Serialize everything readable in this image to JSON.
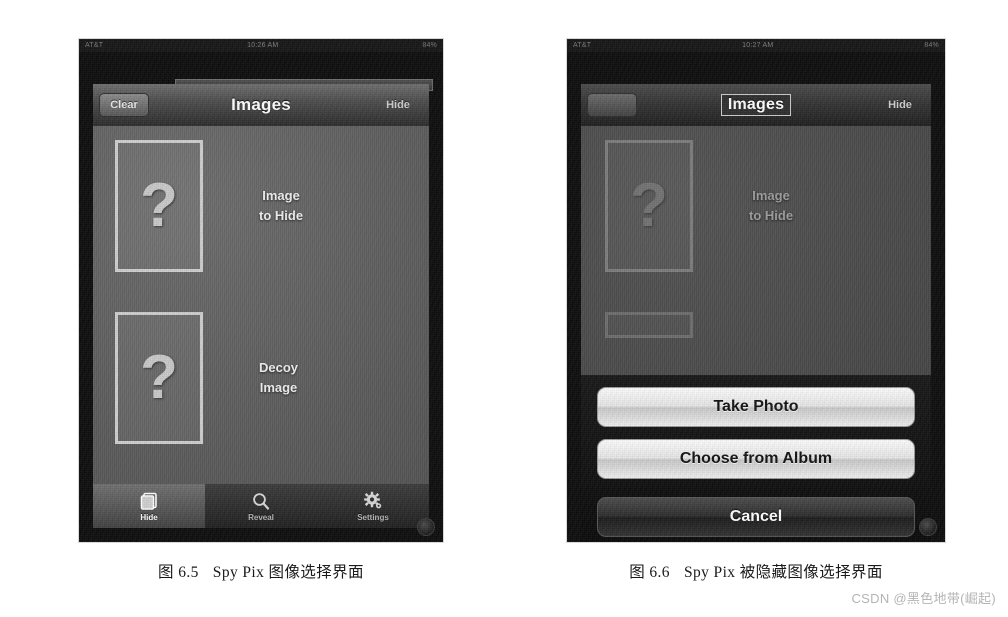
{
  "page": {
    "background_color": "#ffffff",
    "watermark": "CSDN @黑色地带(崛起)"
  },
  "figures": [
    {
      "id": "figure-6-5",
      "caption_number": "图 6.5",
      "caption_text": "Spy Pix 图像选择界面",
      "screen": {
        "status_bar": {
          "carrier": "AT&T",
          "time": "10:26 AM",
          "battery": "84%"
        },
        "nav_bar": {
          "left_button": "Clear",
          "title": "Images",
          "right_button": "Hide"
        },
        "slots": [
          {
            "thumbnail_placeholder": "?",
            "label_line1": "Image",
            "label_line2": "to Hide"
          },
          {
            "thumbnail_placeholder": "?",
            "label_line1": "Decoy",
            "label_line2": "Image"
          }
        ],
        "tab_bar": [
          {
            "label": "Hide",
            "icon": "layers-icon",
            "selected": true
          },
          {
            "label": "Reveal",
            "icon": "magnifier-icon",
            "selected": false
          },
          {
            "label": "Settings",
            "icon": "gear-icon",
            "selected": false
          }
        ]
      }
    },
    {
      "id": "figure-6-6",
      "caption_number": "图 6.6",
      "caption_text": "Spy Pix 被隐藏图像选择界面",
      "screen": {
        "status_bar": {
          "carrier": "AT&T",
          "time": "10:27 AM",
          "battery": "84%"
        },
        "nav_bar": {
          "left_button": "",
          "title": "Images",
          "right_button": "Hide"
        },
        "slots": [
          {
            "thumbnail_placeholder": "?",
            "label_line1": "Image",
            "label_line2": "to Hide"
          }
        ],
        "action_sheet": {
          "buttons": [
            {
              "label": "Take Photo",
              "style": "light"
            },
            {
              "label": "Choose from Album",
              "style": "light"
            },
            {
              "label": "Cancel",
              "style": "dark"
            }
          ]
        }
      }
    }
  ]
}
